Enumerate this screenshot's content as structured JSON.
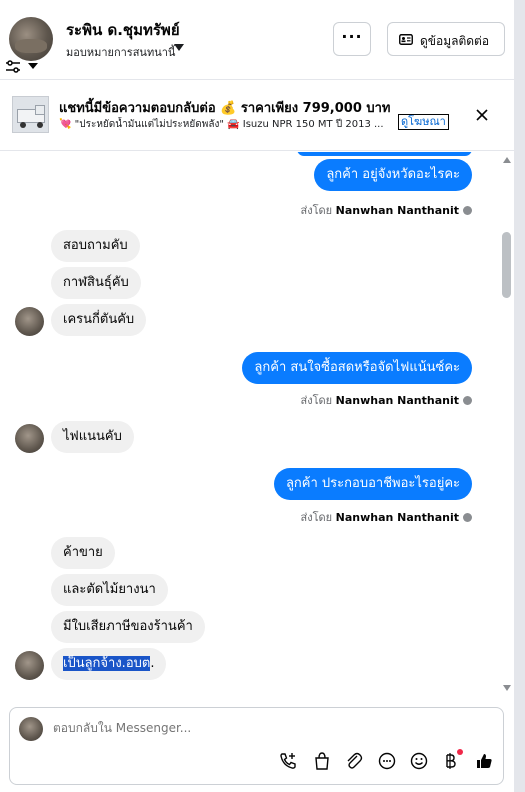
{
  "header": {
    "contact_name": "ระพิน ด.ชุมทรัพย์",
    "assign_label": "มอบหมายการสนทนานี้",
    "more_label": "···",
    "contact_info_label": "ดูข้อมูลติดต่อ"
  },
  "ad": {
    "title": "แชทนี้มีข้อความตอบกลับต่อ 💰 ราคาเพียง 799,000 บาท",
    "subtitle": "💘 \"ประหยัดน้ำมันแต่ไม่ประหยัดพลัง\" 🚘 Isuzu NPR 150 MT ปี 2013 ...",
    "link_label": "ดูโฆษณา"
  },
  "messages": [
    {
      "side": "out",
      "text": "ลูกค้า อยู่จังหวัดอะไรคะ"
    },
    {
      "side": "sent_by",
      "prefix": "ส่งโดย",
      "name": "Nanwhan Nanthanit"
    },
    {
      "side": "in",
      "text": "สอบถามคับ"
    },
    {
      "side": "in",
      "text": "กาฬสินธุ์คับ"
    },
    {
      "side": "in",
      "text": "เครนกี่ตันคับ"
    },
    {
      "side": "out",
      "text": "ลูกค้า สนใจซื้อสดหรือจัดไฟแน้นซ์คะ"
    },
    {
      "side": "sent_by",
      "prefix": "ส่งโดย",
      "name": "Nanwhan Nanthanit"
    },
    {
      "side": "in",
      "text": "ไฟแนนคับ"
    },
    {
      "side": "out",
      "text": "ลูกค้า ประกอบอาชีพอะไรอยู่คะ"
    },
    {
      "side": "sent_by",
      "prefix": "ส่งโดย",
      "name": "Nanwhan Nanthanit"
    },
    {
      "side": "in",
      "text": "ค้าขาย"
    },
    {
      "side": "in",
      "text": "และตัดไม้ยางนา"
    },
    {
      "side": "in",
      "text": "มีใบเสียภาษีของร้านค้า"
    },
    {
      "side": "in",
      "text_highlight": "เป็นลูกจ้าง.อบต",
      "text_rest": "."
    }
  ],
  "composer": {
    "placeholder": "ตอบกลับใน Messenger..."
  },
  "icons": {
    "filter": "sliders-icon",
    "contact_card": "id-card-icon",
    "close": "close-icon",
    "call": "phone-plus-icon",
    "bag": "shopping-bag-icon",
    "attach": "paperclip-icon",
    "chat": "chat-bubble-icon",
    "emoji": "smiley-icon",
    "baht": "baht-icon",
    "like": "thumbs-up-icon"
  },
  "colors": {
    "outgoing": "#0a7cff",
    "incoming": "#f0f0f0",
    "link": "#0064d1",
    "notification": "#f02849"
  }
}
